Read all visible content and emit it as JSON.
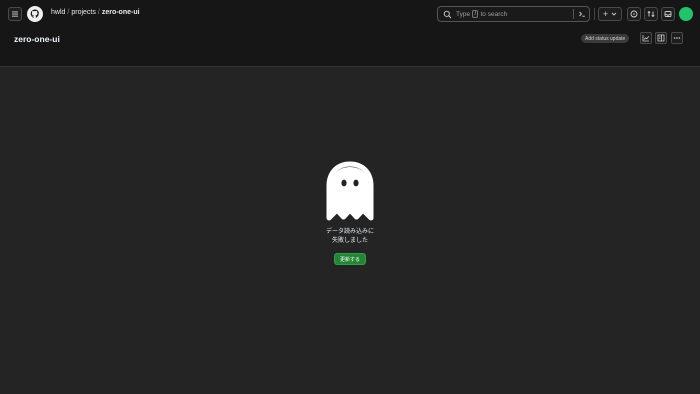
{
  "topbar": {
    "breadcrumb": {
      "owner": "hwld",
      "section": "projects",
      "current": "zero-one-ui",
      "separator": "/"
    },
    "search": {
      "prefix": "Type",
      "key": "/",
      "suffix": "to search"
    },
    "create_label": "+"
  },
  "project": {
    "title": "zero-one-ui",
    "status_button": "Add status update"
  },
  "empty_state": {
    "message": "データ読み込みに\n失敗しました",
    "button": "更新する"
  },
  "colors": {
    "page_bg": "#242424",
    "bar_bg": "#161616",
    "accent_green": "#238636",
    "avatar": "#21c36b"
  },
  "icons": [
    "menu-icon",
    "github-logo",
    "search-icon",
    "terminal-icon",
    "plus-icon",
    "chevron-down-icon",
    "issues-icon",
    "pull-requests-icon",
    "inbox-icon",
    "chart-icon",
    "layout-icon",
    "more-icon",
    "ghost-icon"
  ]
}
